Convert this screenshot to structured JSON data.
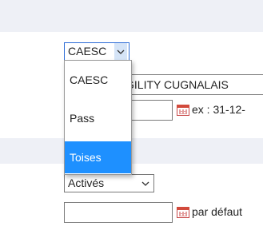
{
  "type_select": {
    "value": "CAESC",
    "options": [
      "CAESC",
      "Pass",
      "Toises"
    ],
    "highlighted": "Toises"
  },
  "club_field": {
    "value": "GILITY CUGNALAIS"
  },
  "date_field": {
    "hint": "ex : 31-12-"
  },
  "active_select": {
    "value": "Activés"
  },
  "default_date_field": {
    "hint": "par défaut"
  },
  "colors": {
    "highlight": "#1e90ff",
    "band": "#eef0f6",
    "focus_border": "#2d6dd6"
  },
  "icons": {
    "calendar": "calendar-icon",
    "chevron": "chevron-down-icon"
  }
}
